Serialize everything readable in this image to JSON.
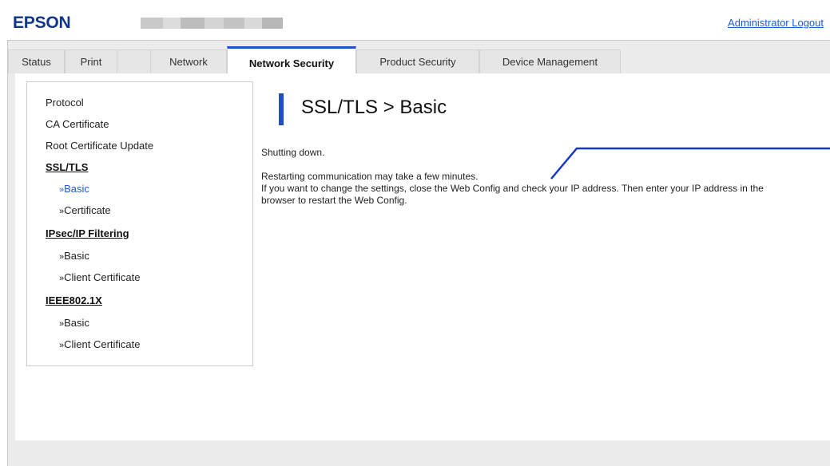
{
  "header": {
    "logo": "EPSON",
    "printer_name_blocks": [
      "#c9c9c9",
      "#dcdcdc",
      "#bdbdbd",
      "#d4d4d4",
      "#c4c4c4",
      "#dadada",
      "#b8b8b8"
    ],
    "admin_logout": "Administrator Logout"
  },
  "tabs": [
    {
      "label": "Status",
      "active": false
    },
    {
      "label": "Print",
      "active": false
    },
    {
      "label": "Network",
      "active": false
    },
    {
      "label": "Network Security",
      "active": true
    },
    {
      "label": "Product Security",
      "active": false
    },
    {
      "label": "Device Management",
      "active": false
    }
  ],
  "sidebar": {
    "protocol": "Protocol",
    "ca_certificate": "CA Certificate",
    "root_certificate_update": "Root Certificate Update",
    "ssl_tls": "SSL/TLS",
    "ssl_basic": "Basic",
    "ssl_certificate": "Certificate",
    "ipsec": "IPsec/IP Filtering",
    "ipsec_basic": "Basic",
    "ipsec_client_certificate": "Client Certificate",
    "ieee": "IEEE802.1X",
    "ieee_basic": "Basic",
    "ieee_client_certificate": "Client Certificate",
    "bullet": "»"
  },
  "main": {
    "title": "SSL/TLS > Basic",
    "status": "Shutting down.",
    "line1": "Restarting communication may take a few minutes.",
    "line2": "If you want to change the settings, close the Web Config and check your IP address. Then enter your IP address in the",
    "line3": "browser to restart the Web Config."
  },
  "colors": {
    "brand": "#10358c",
    "accent": "#1f4ec9",
    "link": "#1f5bd6",
    "callout": "#1535c8"
  }
}
